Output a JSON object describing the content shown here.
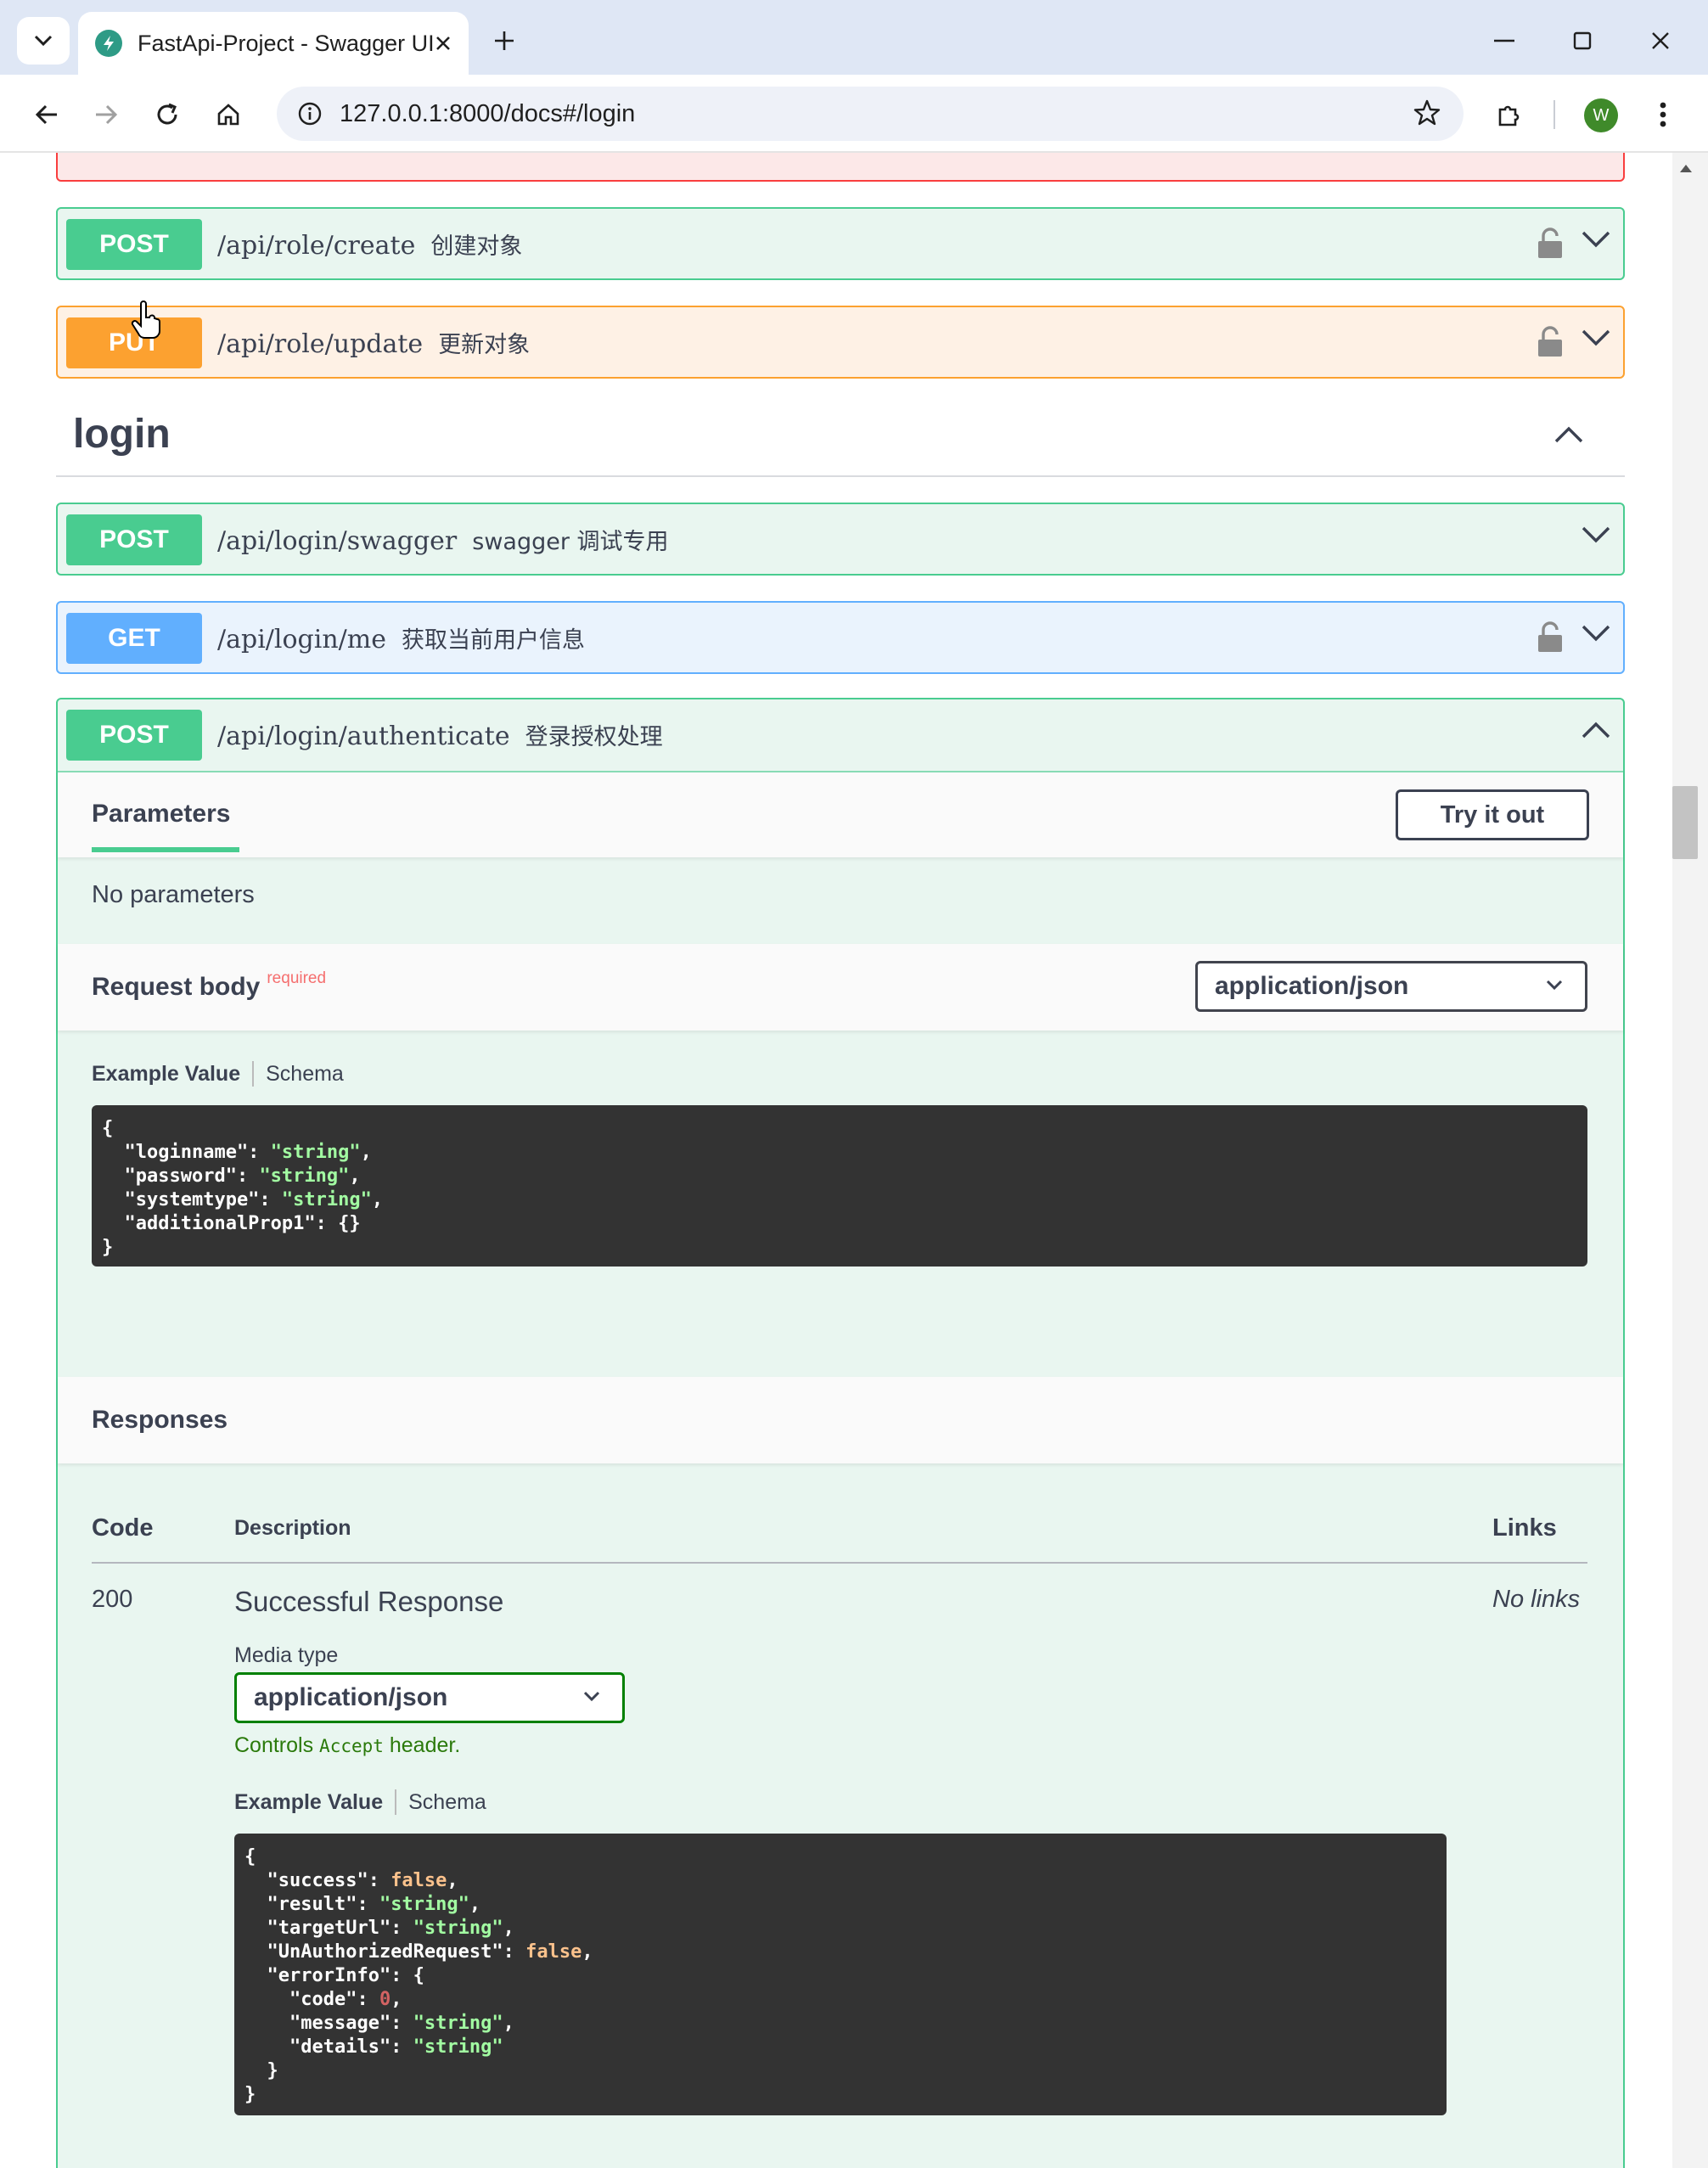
{
  "browser": {
    "tab_title": "FastApi-Project - Swagger UI",
    "url": "127.0.0.1:8000/docs#/login",
    "profile_initial": "W"
  },
  "colors": {
    "post": "#49cc90",
    "put": "#fca130",
    "get": "#61affe",
    "delete": "#f93e3e",
    "text": "#3b4151"
  },
  "ops_top": [
    {
      "method": "POST",
      "path": "/api/role/create",
      "summary": "创建对象"
    },
    {
      "method": "PUT",
      "path": "/api/role/update",
      "summary": "更新对象"
    }
  ],
  "tag": {
    "name": "login"
  },
  "ops_login": [
    {
      "method": "POST",
      "path": "/api/login/swagger",
      "summary": "swagger 调试专用"
    },
    {
      "method": "GET",
      "path": "/api/login/me",
      "summary": "获取当前用户信息"
    },
    {
      "method": "POST",
      "path": "/api/login/authenticate",
      "summary": "登录授权处理"
    }
  ],
  "expanded": {
    "parameters_label": "Parameters",
    "try_it_out": "Try it out",
    "no_parameters": "No parameters",
    "request_body_label": "Request body",
    "required_label": "required",
    "content_type": "application/json",
    "example_value": "Example Value",
    "schema": "Schema",
    "responses_label": "Responses",
    "col_code": "Code",
    "col_description": "Description",
    "col_links": "Links",
    "response_code": "200",
    "response_description": "Successful Response",
    "no_links": "No links",
    "media_type_label": "Media type",
    "media_type_value": "application/json",
    "controls_prefix": "Controls",
    "controls_code": "Accept",
    "controls_suffix": "header."
  }
}
